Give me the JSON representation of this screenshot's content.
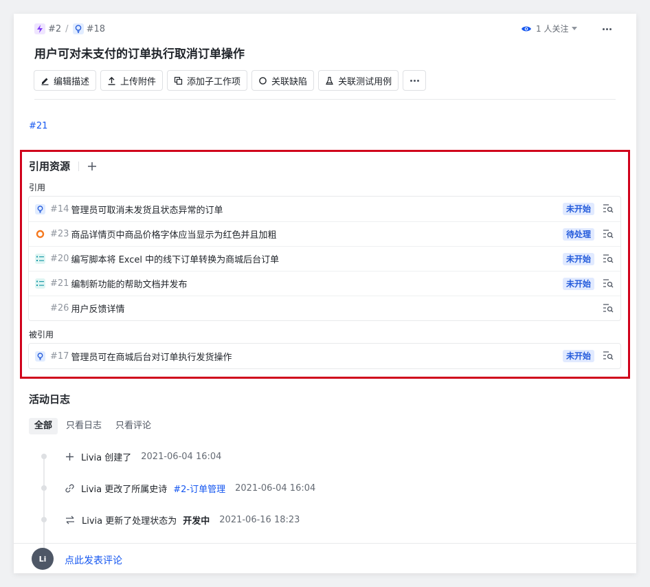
{
  "breadcrumb": {
    "epic_id": "#2",
    "sep": "/",
    "story_id": "#18"
  },
  "watch": {
    "label": "1 人关注"
  },
  "title": "用户可对未支付的订单执行取消订单操作",
  "toolbar": {
    "edit": "编辑描述",
    "upload": "上传附件",
    "add_child": "添加子工作项",
    "link_bug": "关联缺陷",
    "link_test": "关联测试用例"
  },
  "description_link": "#21",
  "references": {
    "title": "引用资源",
    "refs_label": "引用",
    "refs": [
      {
        "type": "story",
        "id": "#14",
        "name": "管理员可取消未发货且状态异常的订单",
        "status": "未开始"
      },
      {
        "type": "bug",
        "id": "#23",
        "name": "商品详情页中商品价格字体应当显示为红色并且加粗",
        "status": "待处理"
      },
      {
        "type": "task",
        "id": "#20",
        "name": "编写脚本将 Excel 中的线下订单转换为商城后台订单",
        "status": "未开始"
      },
      {
        "type": "task",
        "id": "#21",
        "name": "编制新功能的帮助文档并发布",
        "status": "未开始"
      },
      {
        "type": "none",
        "id": "#26",
        "name": "用户反馈详情",
        "status": ""
      }
    ],
    "referenced_label": "被引用",
    "referenced_by": [
      {
        "type": "story",
        "id": "#17",
        "name": "管理员可在商城后台对订单执行发货操作",
        "status": "未开始"
      }
    ]
  },
  "activity": {
    "title": "活动日志",
    "tabs": [
      "全部",
      "只看日志",
      "只看评论"
    ],
    "events": [
      {
        "icon": "plus-icon",
        "text": "Livia 创建了",
        "extra": "",
        "time": "2021-06-04 16:04"
      },
      {
        "icon": "link-icon",
        "text": "Livia 更改了所属史诗",
        "extra": "#2-订单管理",
        "time": "2021-06-04 16:04"
      },
      {
        "icon": "swap-icon",
        "text": "Livia 更新了处理状态为",
        "extra": "开发中",
        "time": "2021-06-16 18:23"
      }
    ]
  },
  "comment": {
    "avatar": "Li",
    "prompt": "点此发表评论"
  }
}
